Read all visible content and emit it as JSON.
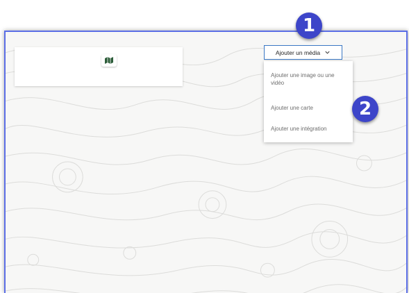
{
  "toolbar": {
    "add_media_label": "Ajouter un média"
  },
  "media_menu": {
    "items": [
      {
        "label": "Ajouter une image ou une vidéo"
      },
      {
        "label": "Ajouter une carte"
      },
      {
        "label": "Ajouter une intégration"
      }
    ]
  },
  "callouts": {
    "one": "1",
    "two": "2"
  },
  "colors": {
    "accent_border": "#5b6ee6",
    "button_border": "#3a77c4",
    "callout_badge": "#3d45c9"
  },
  "icons": {
    "card_handle": "map-layer-icon",
    "button_chevron": "chevron-down-icon"
  }
}
